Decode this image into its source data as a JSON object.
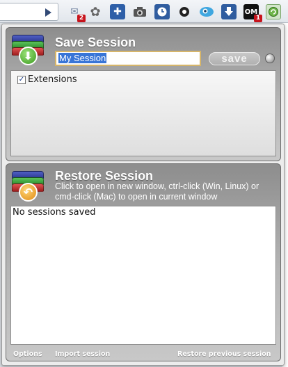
{
  "save": {
    "title": "Save Session",
    "input_value": "My Session",
    "button_label": "save",
    "extensions_label": "Extensions",
    "extensions_checked": true
  },
  "restore": {
    "title": "Restore Session",
    "subtitle": "Click to open in new window, ctrl-click (Win, Linux) or cmd-click (Mac) to open in current window",
    "empty_message": "No sessions saved"
  },
  "footer": {
    "options": "Options",
    "import": "Import session",
    "restore_previous": "Restore previous session"
  },
  "toolbar": {
    "badge_mail": "2",
    "badge_om": "1",
    "om_label": "OM"
  },
  "colors": {
    "panel_gray": "#9e9e9e",
    "input_border": "#d6b56a",
    "selection_blue": "#3875d7",
    "badge_red": "#c8141c"
  }
}
